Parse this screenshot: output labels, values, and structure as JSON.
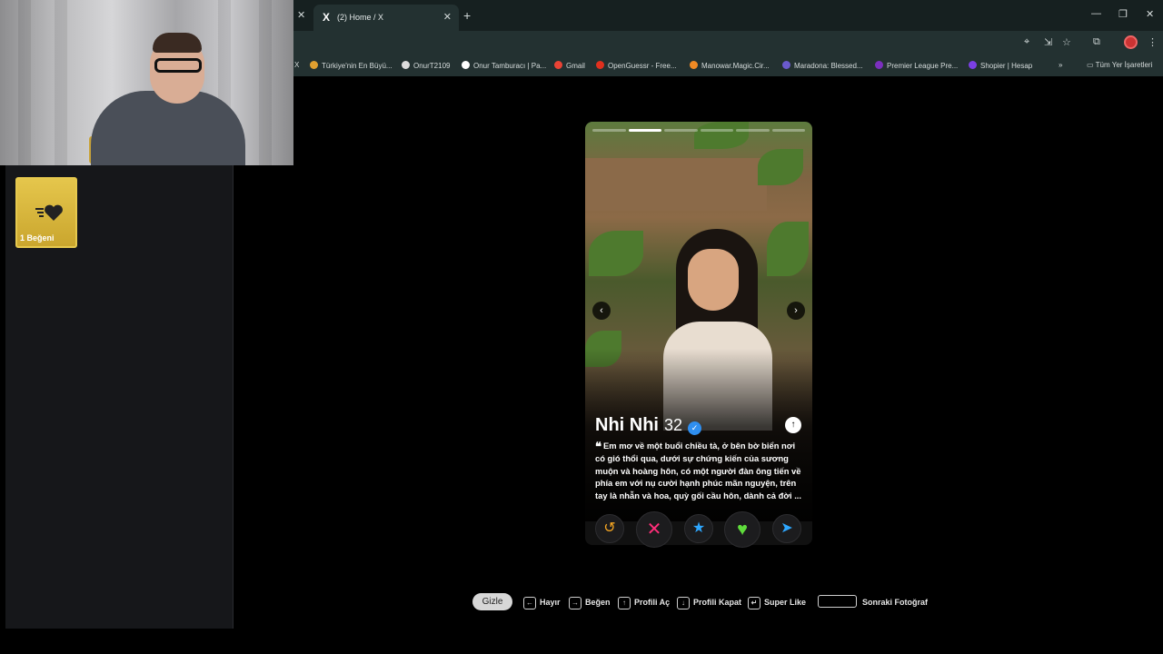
{
  "sidebar": {
    "like_card_label": "1 Beğeni"
  },
  "browser": {
    "tab_title": "(2) Home / X",
    "tab_favicon": "X",
    "bookmarks": [
      {
        "label": "Türkiye'nin En Büyü...",
        "color": "#e0a030"
      },
      {
        "label": "OnurT2109",
        "color": "#dddddd"
      },
      {
        "label": "Onur Tamburacı | Pa...",
        "color": "#ffffff"
      },
      {
        "label": "Gmail",
        "color": "#ea4335"
      },
      {
        "label": "OpenGuessr - Free...",
        "color": "#e0301e"
      },
      {
        "label": "Manowar.Magic.Cir...",
        "color": "#f08a24"
      },
      {
        "label": "Maradona: Blessed...",
        "color": "#6a5acd"
      },
      {
        "label": "Premier League Pre...",
        "color": "#7b2fbe"
      },
      {
        "label": "Shopier | Hesap",
        "color": "#7b3fe4"
      }
    ],
    "all_bookmarks_label": "Tüm Yer İşaretleri"
  },
  "profile": {
    "name": "Nhi Nhi",
    "age": "32",
    "bio": "Em mơ về một buổi chiều tà, ở bên bờ biển nơi có gió thổi qua, dưới sự chứng kiến của sương muộn và hoàng hôn, có một người đàn ông tiến về phía em với nụ cười hạnh phúc mãn nguyện, trên tay là nhẫn và hoa, quỳ gối cầu hôn, dành cả đời ...",
    "photo_count": 6,
    "current_photo": 2
  },
  "actions": {
    "rewind_icon": "↺",
    "nope_icon": "✕",
    "superlike_icon": "★",
    "like_icon": "♥",
    "boost_icon": "➤"
  },
  "shortcuts": {
    "hide_label": "Gizle",
    "items": [
      {
        "key": "←",
        "label": "Hayır"
      },
      {
        "key": "→",
        "label": "Beğen"
      },
      {
        "key": "↑",
        "label": "Profili Aç"
      },
      {
        "key": "↓",
        "label": "Profili Kapat"
      },
      {
        "key": "↵",
        "label": "Super Like"
      }
    ],
    "next_photo_label": "Sonraki Fotoğraf"
  },
  "colors": {
    "like_card": "#e5c64c",
    "nope": "#ff2e7a",
    "like": "#5fdc3c",
    "superlike": "#2ea7ff",
    "rewind": "#f5a623",
    "boost": "#2ea7ff",
    "verified": "#2f8ff0"
  }
}
